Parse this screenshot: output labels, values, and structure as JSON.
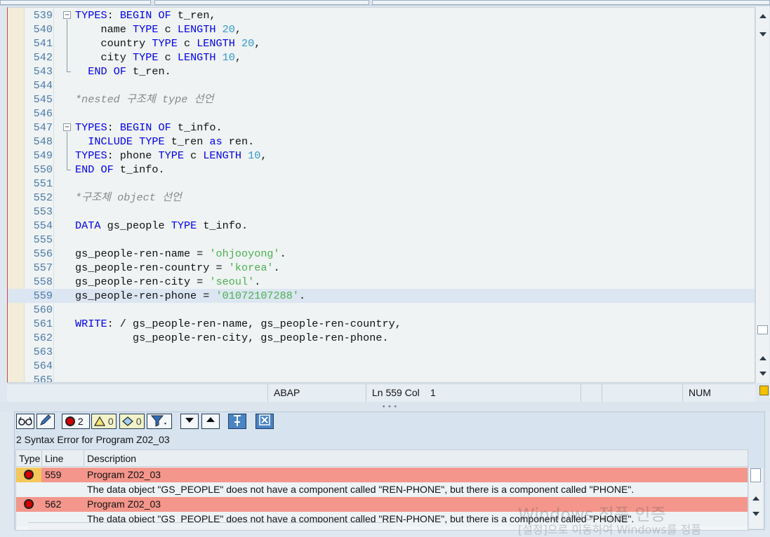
{
  "editor": {
    "lines": [
      {
        "n": "539",
        "fold": "open",
        "tokens": [
          [
            "kw",
            "TYPES"
          ],
          [
            "id",
            ": "
          ],
          [
            "kw",
            "BEGIN"
          ],
          [
            "id",
            " "
          ],
          [
            "kw",
            "OF"
          ],
          [
            "id",
            " t_ren,"
          ]
        ]
      },
      {
        "n": "540",
        "tokens": [
          [
            "id",
            "    name "
          ],
          [
            "kw",
            "TYPE"
          ],
          [
            "id",
            " c "
          ],
          [
            "kw",
            "LENGTH"
          ],
          [
            "id",
            " "
          ],
          [
            "num",
            "20"
          ],
          [
            "id",
            ","
          ]
        ]
      },
      {
        "n": "541",
        "tokens": [
          [
            "id",
            "    country "
          ],
          [
            "kw",
            "TYPE"
          ],
          [
            "id",
            " c "
          ],
          [
            "kw",
            "LENGTH"
          ],
          [
            "id",
            " "
          ],
          [
            "num",
            "20"
          ],
          [
            "id",
            ","
          ]
        ]
      },
      {
        "n": "542",
        "tokens": [
          [
            "id",
            "    city "
          ],
          [
            "kw",
            "TYPE"
          ],
          [
            "id",
            " c "
          ],
          [
            "kw",
            "LENGTH"
          ],
          [
            "id",
            " "
          ],
          [
            "num",
            "10"
          ],
          [
            "id",
            ","
          ]
        ]
      },
      {
        "n": "543",
        "fold": "end",
        "tokens": [
          [
            "id",
            "  "
          ],
          [
            "kw",
            "END"
          ],
          [
            "id",
            " "
          ],
          [
            "kw",
            "OF"
          ],
          [
            "id",
            " t_ren."
          ]
        ]
      },
      {
        "n": "544",
        "tokens": []
      },
      {
        "n": "545",
        "tokens": [
          [
            "cmt",
            "*nested 구조체 type 선언"
          ]
        ]
      },
      {
        "n": "546",
        "tokens": []
      },
      {
        "n": "547",
        "fold": "open",
        "tokens": [
          [
            "kw",
            "TYPES"
          ],
          [
            "id",
            ": "
          ],
          [
            "kw",
            "BEGIN"
          ],
          [
            "id",
            " "
          ],
          [
            "kw",
            "OF"
          ],
          [
            "id",
            " t_info."
          ]
        ]
      },
      {
        "n": "548",
        "tokens": [
          [
            "id",
            "  "
          ],
          [
            "kw",
            "INCLUDE"
          ],
          [
            "id",
            " "
          ],
          [
            "kw",
            "TYPE"
          ],
          [
            "id",
            " t_ren "
          ],
          [
            "kw",
            "as"
          ],
          [
            "id",
            " ren."
          ]
        ]
      },
      {
        "n": "549",
        "tokens": [
          [
            "kw",
            "TYPES"
          ],
          [
            "id",
            ": phone "
          ],
          [
            "kw",
            "TYPE"
          ],
          [
            "id",
            " c "
          ],
          [
            "kw",
            "LENGTH"
          ],
          [
            "id",
            " "
          ],
          [
            "num",
            "10"
          ],
          [
            "id",
            ","
          ]
        ]
      },
      {
        "n": "550",
        "fold": "end",
        "tokens": [
          [
            "kw",
            "END"
          ],
          [
            "id",
            " "
          ],
          [
            "kw",
            "OF"
          ],
          [
            "id",
            " t_info."
          ]
        ]
      },
      {
        "n": "551",
        "tokens": []
      },
      {
        "n": "552",
        "tokens": [
          [
            "cmt",
            "*구조체 object 선언"
          ]
        ]
      },
      {
        "n": "553",
        "tokens": []
      },
      {
        "n": "554",
        "tokens": [
          [
            "kw",
            "DATA"
          ],
          [
            "id",
            " gs_people "
          ],
          [
            "kw",
            "TYPE"
          ],
          [
            "id",
            " t_info."
          ]
        ]
      },
      {
        "n": "555",
        "tokens": []
      },
      {
        "n": "556",
        "tokens": [
          [
            "id",
            "gs_people-ren-name = "
          ],
          [
            "str",
            "'ohjooyong'"
          ],
          [
            "id",
            "."
          ]
        ]
      },
      {
        "n": "557",
        "tokens": [
          [
            "id",
            "gs_people-ren-country = "
          ],
          [
            "str",
            "'korea'"
          ],
          [
            "id",
            "."
          ]
        ]
      },
      {
        "n": "558",
        "tokens": [
          [
            "id",
            "gs_people-ren-city = "
          ],
          [
            "str",
            "'seoul'"
          ],
          [
            "id",
            "."
          ]
        ]
      },
      {
        "n": "559",
        "current": true,
        "tokens": [
          [
            "id",
            "gs_people-ren-phone = "
          ],
          [
            "str",
            "'01072107288'"
          ],
          [
            "id",
            "."
          ]
        ]
      },
      {
        "n": "560",
        "tokens": []
      },
      {
        "n": "561",
        "tokens": [
          [
            "kw",
            "WRITE"
          ],
          [
            "id",
            ": / gs_people-ren-name, gs_people-ren-country,"
          ]
        ]
      },
      {
        "n": "562",
        "tokens": [
          [
            "id",
            "         gs_people-ren-city, gs_people-ren-phone."
          ]
        ]
      },
      {
        "n": "563",
        "tokens": []
      },
      {
        "n": "564",
        "tokens": []
      },
      {
        "n": "565",
        "tokens": []
      }
    ]
  },
  "status": {
    "language": "ABAP",
    "ln_label": "Ln 559 Col",
    "col_value": "1",
    "num_label": "NUM"
  },
  "toolbar": {
    "error_count": "2",
    "warning_count": "0",
    "info_count": "0"
  },
  "panel": {
    "title": "2 Syntax Error for Program Z02_03",
    "columns": {
      "type": "Type",
      "line": "Line",
      "description": "Description"
    },
    "rows": [
      {
        "line": "559",
        "program": "Program Z02_03",
        "message": "The data object \"GS_PEOPLE\" does not have a component called \"REN-PHONE\", but there is a component called \"PHONE\"."
      },
      {
        "line": "562",
        "program": "Program Z02_03",
        "message": "The data object \"GS_PEOPLE\" does not have a component called \"REN-PHONE\", but there is a component called \"PHONE\"."
      }
    ]
  },
  "watermark": {
    "line1": "Windows 정품 인증",
    "line2": "[설정]으로 이동하여 Windows를 정품"
  },
  "colors": {
    "keyword": "#0000e6",
    "number": "#3399cc",
    "string": "#4caf50",
    "comment": "#888888",
    "error_row": "#f4968b"
  }
}
